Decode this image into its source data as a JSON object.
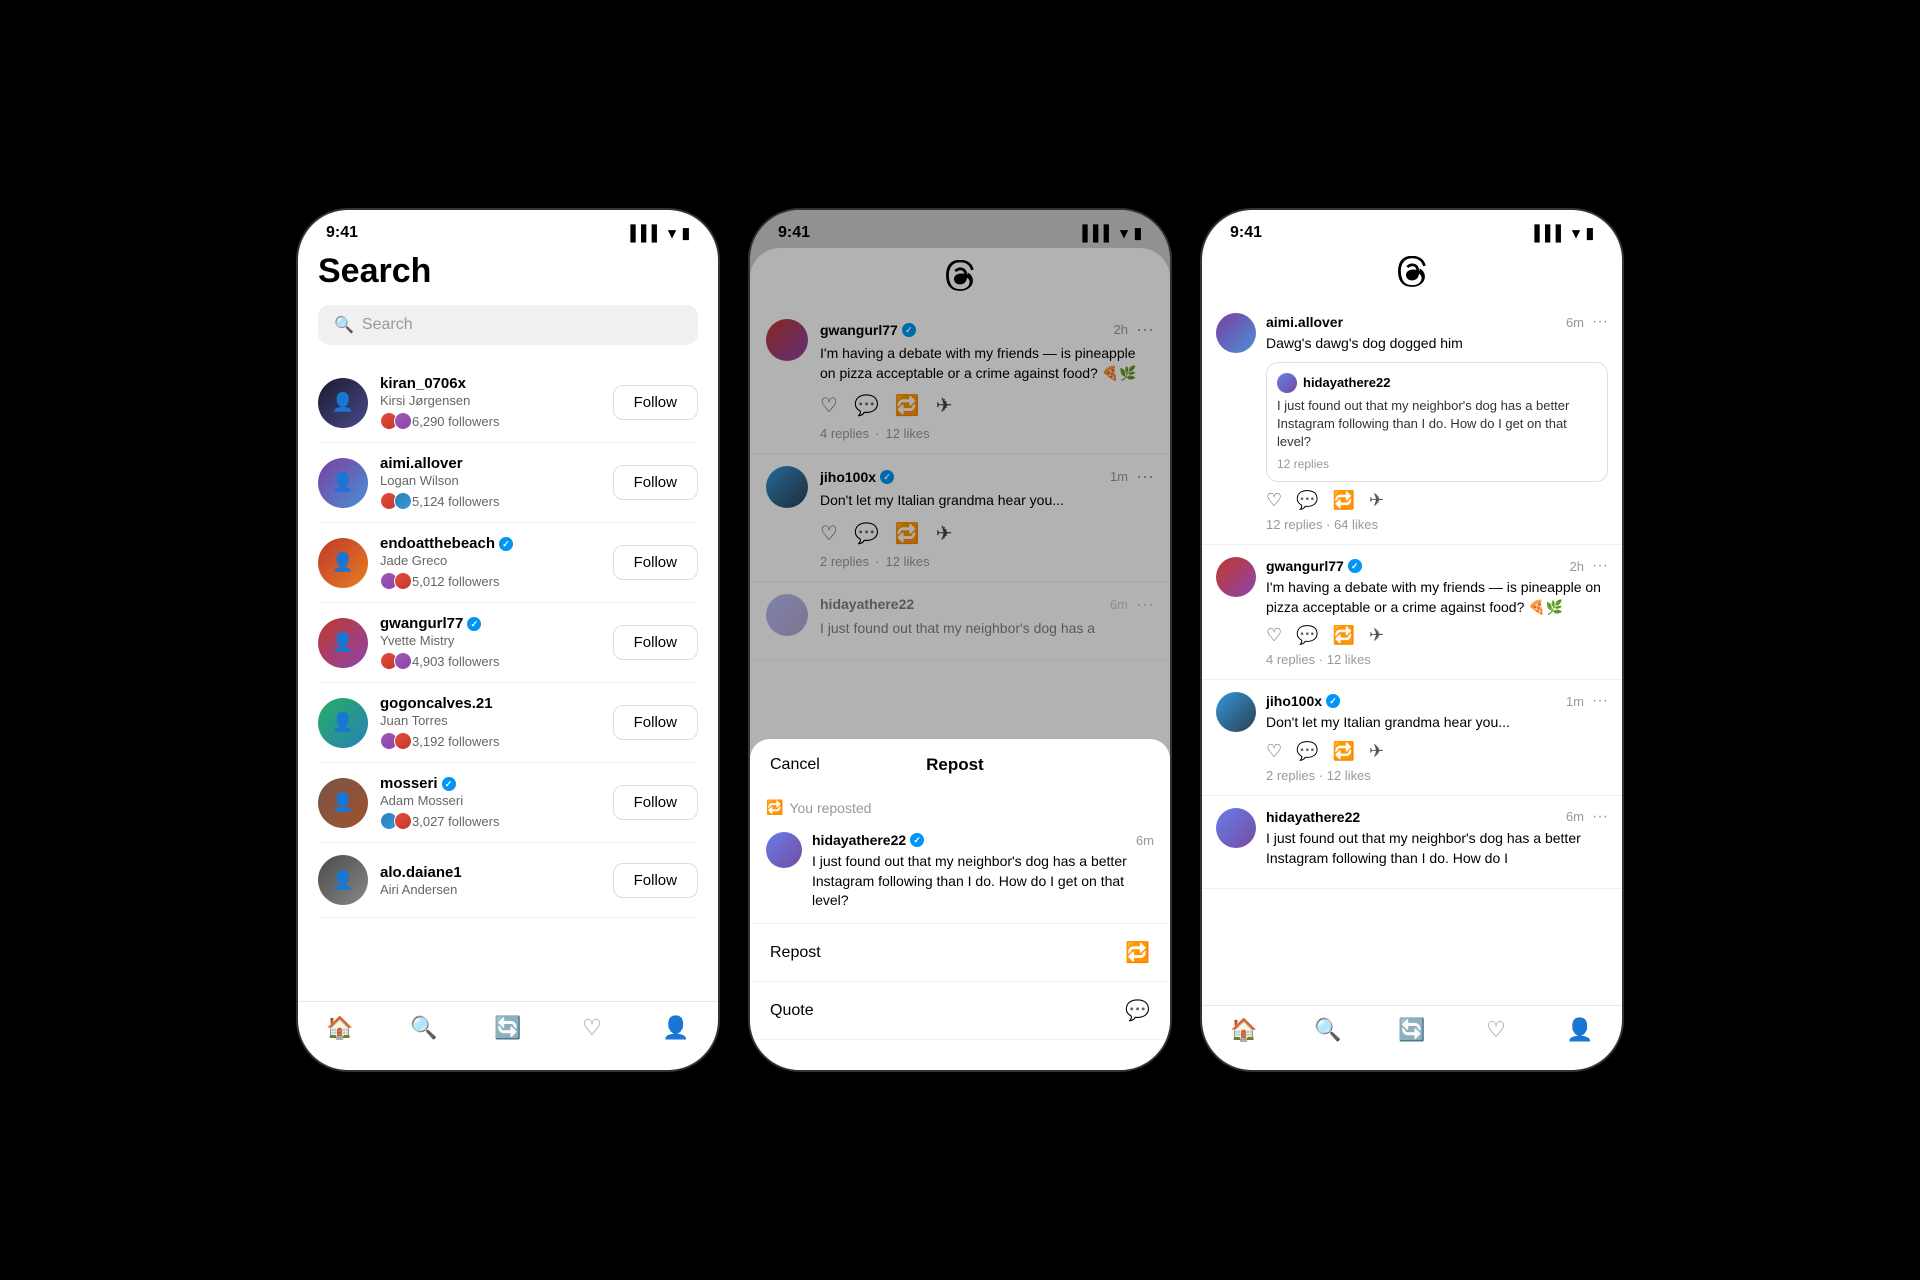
{
  "phone1": {
    "status_time": "9:41",
    "title": "Search",
    "search_placeholder": "Search",
    "users": [
      {
        "id": "kiran",
        "username": "kiran_0706x",
        "real_name": "Kirsi Jørgensen",
        "followers": "6,290 followers",
        "verified": false
      },
      {
        "id": "aimi",
        "username": "aimi.allover",
        "real_name": "Logan Wilson",
        "followers": "5,124 followers",
        "verified": false
      },
      {
        "id": "endo",
        "username": "endoatthebeach",
        "real_name": "Jade Greco",
        "followers": "5,012 followers",
        "verified": true
      },
      {
        "id": "gwang",
        "username": "gwangurl77",
        "real_name": "Yvette Mistry",
        "followers": "4,903 followers",
        "verified": true
      },
      {
        "id": "gogo",
        "username": "gogoncalves.21",
        "real_name": "Juan Torres",
        "followers": "3,192 followers",
        "verified": false
      },
      {
        "id": "mosseri",
        "username": "mosseri",
        "real_name": "Adam Mosseri",
        "followers": "3,027 followers",
        "verified": true
      },
      {
        "id": "alo",
        "username": "alo.daiane1",
        "real_name": "Airi Andersen",
        "followers": "",
        "verified": false
      }
    ],
    "follow_label": "Follow",
    "nav": [
      "🏠",
      "🔍",
      "🔄",
      "♡",
      "👤"
    ]
  },
  "phone2": {
    "status_time": "9:41",
    "logo": "@",
    "threads": [
      {
        "username": "gwangurl77",
        "verified": true,
        "time": "2h",
        "text": "I'm having a debate with my friends — is pineapple on pizza acceptable or a crime against food? 🍕🌿",
        "replies": "4 replies",
        "likes": "12 likes"
      },
      {
        "username": "jiho100x",
        "verified": true,
        "time": "1m",
        "text": "Don't let my Italian grandma hear you...",
        "replies": "2 replies",
        "likes": "12 likes"
      },
      {
        "username": "hidayathere22",
        "verified": false,
        "time": "6m",
        "text": "I just found out that my neighbor's dog has a"
      }
    ],
    "sheet": {
      "cancel_label": "Cancel",
      "title": "Repost",
      "reposted_text": "You reposted",
      "post_user": "hidayathere22",
      "post_verified": true,
      "post_time": "6m",
      "post_text": "I just found out that my neighbor's dog has a better Instagram following than I do. How do I get on that level?",
      "repost_label": "Repost",
      "quote_label": "Quote"
    }
  },
  "phone3": {
    "status_time": "9:41",
    "logo": "@",
    "threads": [
      {
        "username": "aimi.allover",
        "verified": false,
        "time": "6m",
        "text": "Dawg's dawg's dog dogged him",
        "quoted": {
          "username": "hidayathere22",
          "text": "I just found out that my neighbor's dog has a better Instagram following than I do. How do I get on that level?",
          "replies": "12 replies"
        },
        "replies": "12 replies",
        "likes": "64 likes"
      },
      {
        "username": "gwangurl77",
        "verified": true,
        "time": "2h",
        "text": "I'm having a debate with my friends — is pineapple on pizza acceptable or a crime against food? 🍕🌿",
        "replies": "4 replies",
        "likes": "12 likes"
      },
      {
        "username": "jiho100x",
        "verified": true,
        "time": "1m",
        "text": "Don't let my Italian grandma hear you...",
        "replies": "2 replies",
        "likes": "12 likes"
      },
      {
        "username": "hidayathere22",
        "verified": false,
        "time": "6m",
        "text": "I just found out that my neighbor's dog has a better Instagram following than I do. How do I"
      }
    ]
  }
}
